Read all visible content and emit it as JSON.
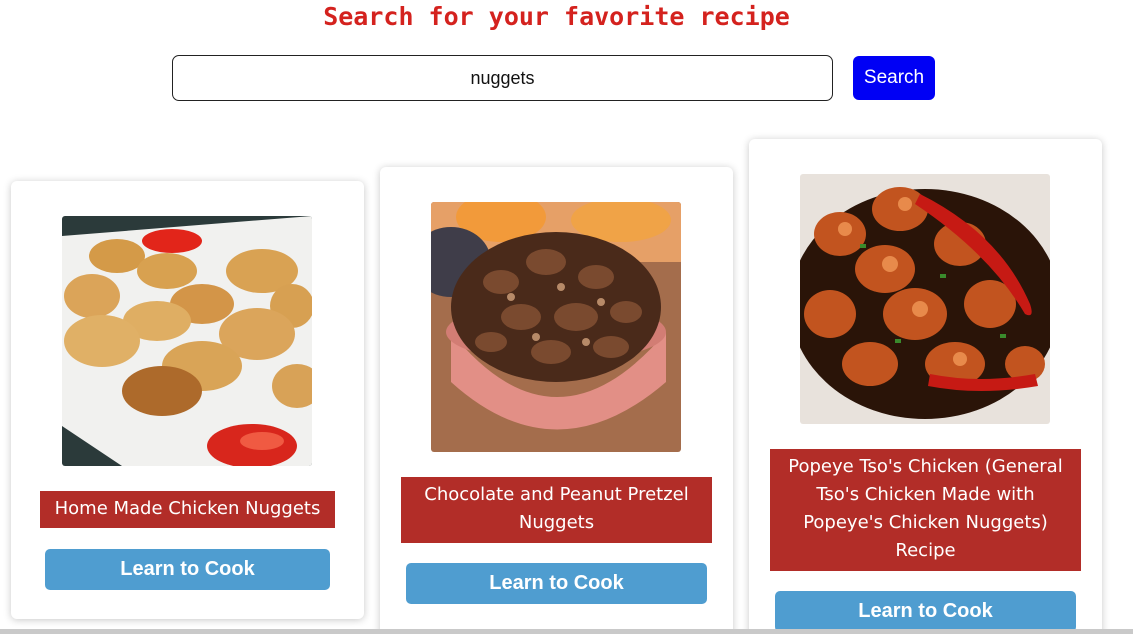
{
  "header": {
    "title": "Search for your favorite recipe"
  },
  "search": {
    "value": "nuggets",
    "button_label": "Search",
    "button_color": "#0000f5"
  },
  "recipes": [
    {
      "image": "chicken-nuggets-photo",
      "title": "Home Made Chicken Nuggets",
      "button_label": "Learn to Cook"
    },
    {
      "image": "pretzel-nuggets-photo",
      "title": "Chocolate and Peanut Pretzel Nuggets",
      "button_label": "Learn to Cook"
    },
    {
      "image": "general-tso-chicken-photo",
      "title": "Popeye Tso's Chicken (General Tso's Chicken Made with Popeye's Chicken Nuggets) Recipe",
      "button_label": "Learn to Cook"
    }
  ],
  "colors": {
    "heading": "#d4221e",
    "title_background": "#b22d28",
    "cook_button": "#4f9dd0"
  }
}
